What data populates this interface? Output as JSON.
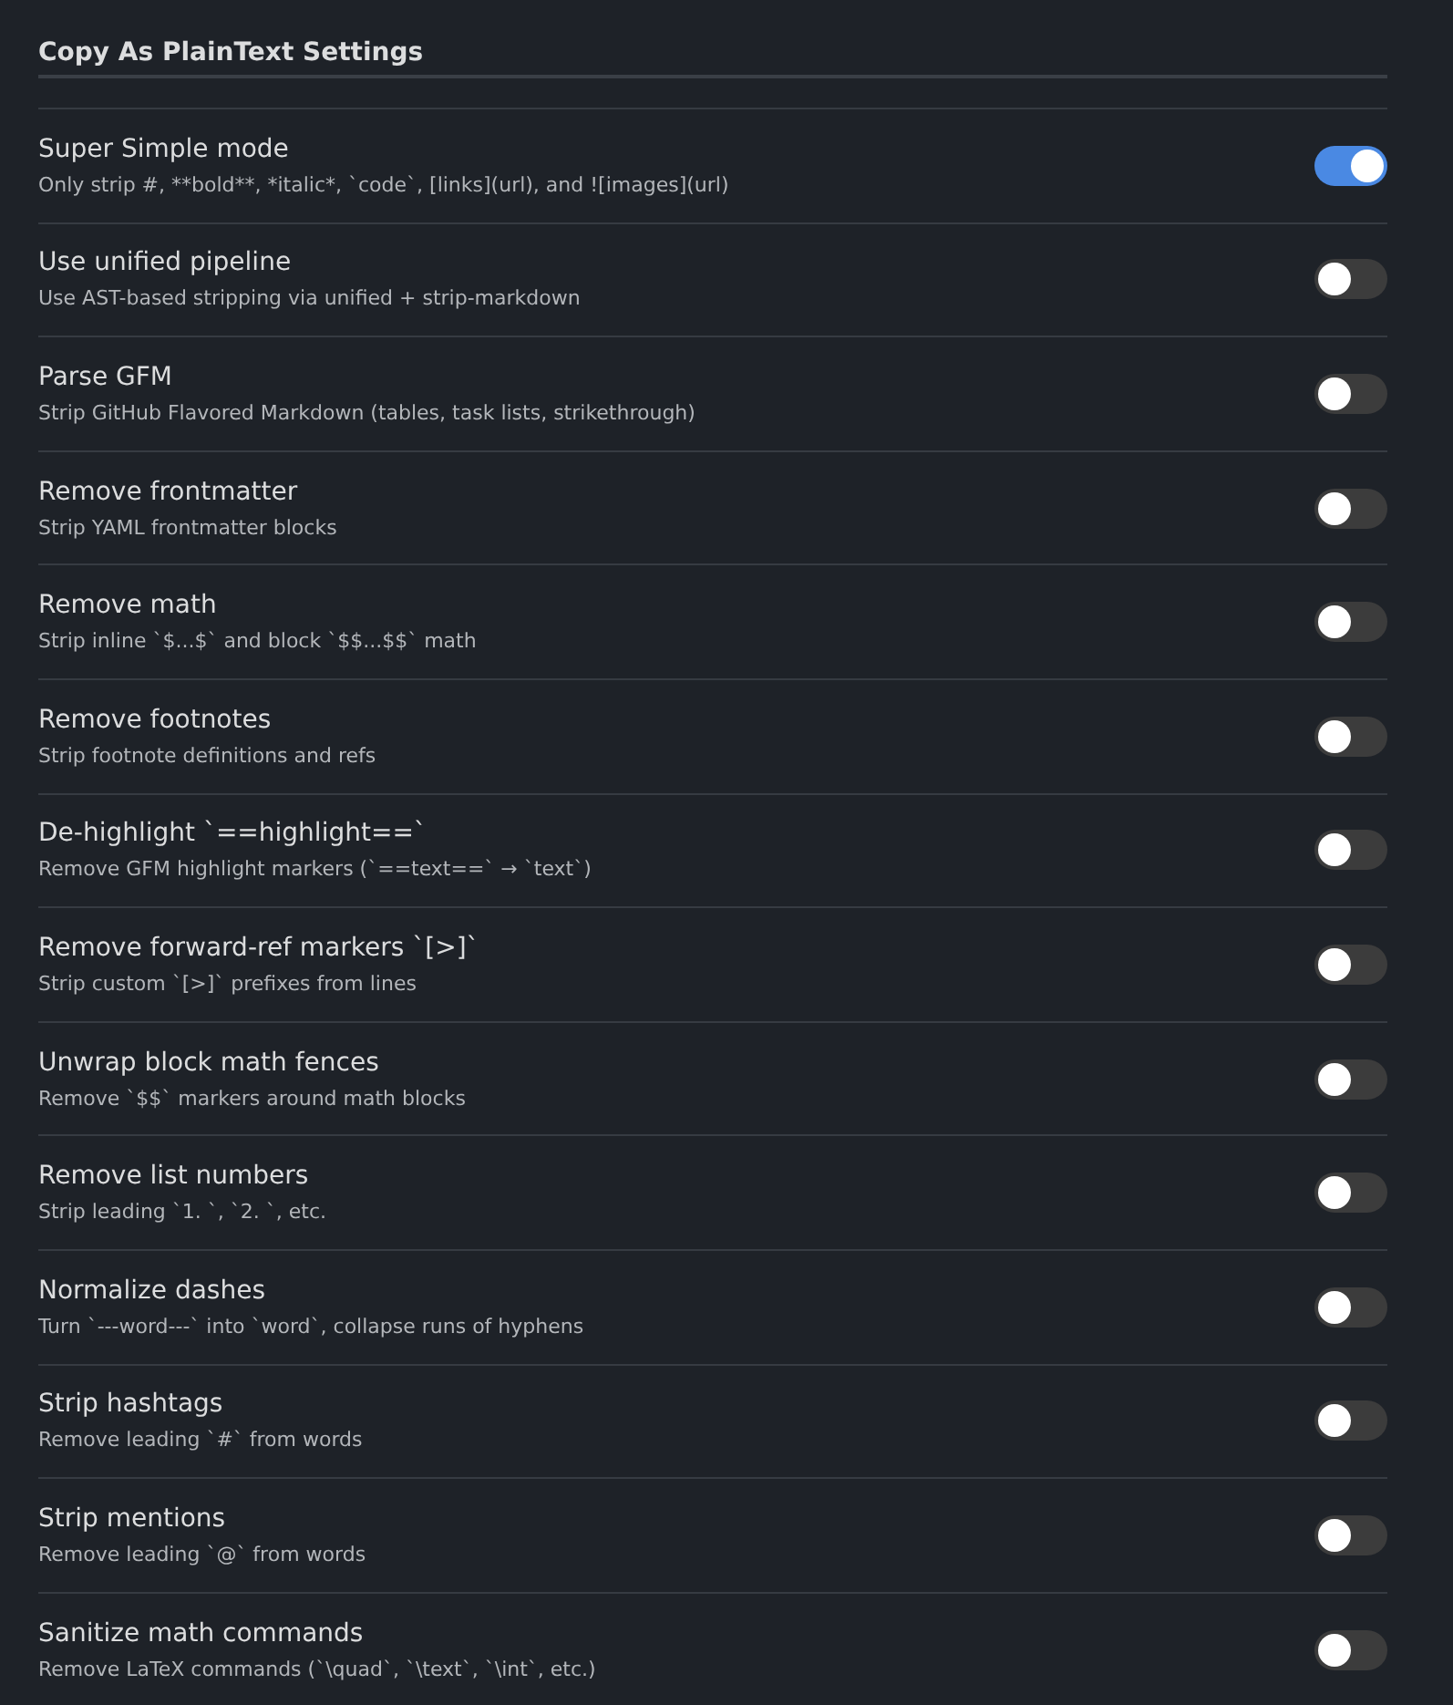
{
  "title": "Copy As PlainText Settings",
  "settings": [
    {
      "name": "Super Simple mode",
      "description": "Only strip #, **bold**, *italic*, `code`, [links](url), and ![images](url)",
      "on": true
    },
    {
      "name": "Use unified pipeline",
      "description": "Use AST-based stripping via unified + strip-markdown",
      "on": false
    },
    {
      "name": "Parse GFM",
      "description": "Strip GitHub Flavored Markdown (tables, task lists, strikethrough)",
      "on": false
    },
    {
      "name": "Remove frontmatter",
      "description": "Strip YAML frontmatter blocks",
      "on": false
    },
    {
      "name": "Remove math",
      "description": "Strip inline `$...$` and block `$$...$$` math",
      "on": false
    },
    {
      "name": "Remove footnotes",
      "description": "Strip footnote definitions and refs",
      "on": false
    },
    {
      "name": "De-highlight `==highlight==`",
      "description": "Remove GFM highlight markers (`==text==` → `text`)",
      "on": false
    },
    {
      "name": "Remove forward-ref markers `[>]`",
      "description": "Strip custom `[>]` prefixes from lines",
      "on": false
    },
    {
      "name": "Unwrap block math fences",
      "description": "Remove `$$` markers around math blocks",
      "on": false
    },
    {
      "name": "Remove list numbers",
      "description": "Strip leading `1. `, `2. `, etc.",
      "on": false
    },
    {
      "name": "Normalize dashes",
      "description": "Turn `---word---` into `word`, collapse runs of hyphens",
      "on": false
    },
    {
      "name": "Strip hashtags",
      "description": "Remove leading `#` from words",
      "on": false
    },
    {
      "name": "Strip mentions",
      "description": "Remove leading `@` from words",
      "on": false
    },
    {
      "name": "Sanitize math commands",
      "description": "Remove LaTeX commands (`\\quad`, `\\text`, `\\int`, etc.)",
      "on": false
    }
  ]
}
